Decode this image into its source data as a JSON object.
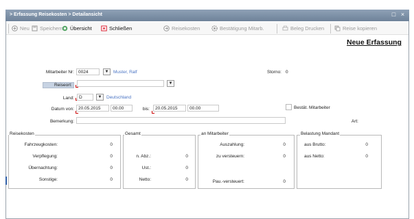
{
  "window": {
    "title": "> Erfassung Reisekosten > Detailansicht",
    "close_glyph": "×",
    "restore_glyph": "□"
  },
  "toolbar": {
    "new": "Neu",
    "save": "Speichern",
    "overview": "Übersicht",
    "close": "Schließen",
    "travel_costs": "Reisekosten",
    "confirm_employee": "Bestätigung Mitarb.",
    "print_voucher": "Beleg Drucken",
    "copy_trip": "Reise kopieren"
  },
  "header": {
    "new_entry": "Neue Erfassung"
  },
  "form": {
    "employee_label": "Mitarbeiter Nr:",
    "employee_nr": "0024",
    "employee_name": "Muster, Ralf",
    "storno_label": "Storno:",
    "storno_value": "0",
    "travel_location_label": "Reiseort:",
    "travel_location_value": "",
    "country_label": "Land:",
    "country_code": "D",
    "country_name": "Deutschland",
    "date_from_label": "Datum von:",
    "date_from": "20.05.2015",
    "time_from": "00.00",
    "date_to_label": "bis:",
    "date_to": "20.05.2015",
    "time_to": "00.00",
    "confirmed_label": "Bestät. Mitarbeiter",
    "remark_label": "Bemerkung:",
    "remark_value": "",
    "type_label": "Art:"
  },
  "groups": {
    "travel_costs": {
      "title": "Reisekosten",
      "rows": [
        {
          "label": "Fahrzeugkosten:",
          "value": "0"
        },
        {
          "label": "Verpflegung:",
          "value": "0"
        },
        {
          "label": "Übernachtung:",
          "value": "0"
        },
        {
          "label": "Sonstige:",
          "value": "0"
        }
      ]
    },
    "total": {
      "title": "Gesamt",
      "rows": [
        {
          "label": "n. Abz.:",
          "value": "0"
        },
        {
          "label": "Ust.:",
          "value": "0"
        },
        {
          "label": "Netto:",
          "value": "0"
        }
      ]
    },
    "employee": {
      "title": "an Mitarbeiter",
      "rows": [
        {
          "label": "Auszahlung:",
          "value": "0"
        },
        {
          "label": "zu versteuern:",
          "value": "0"
        },
        {
          "label": "Pau.-versteuert:",
          "value": "0"
        }
      ]
    },
    "client": {
      "title": "Belastung Mandant",
      "rows": [
        {
          "label": "aus Brutto:",
          "value": "0"
        },
        {
          "label": "aus Netto:",
          "value": "0"
        }
      ]
    }
  }
}
